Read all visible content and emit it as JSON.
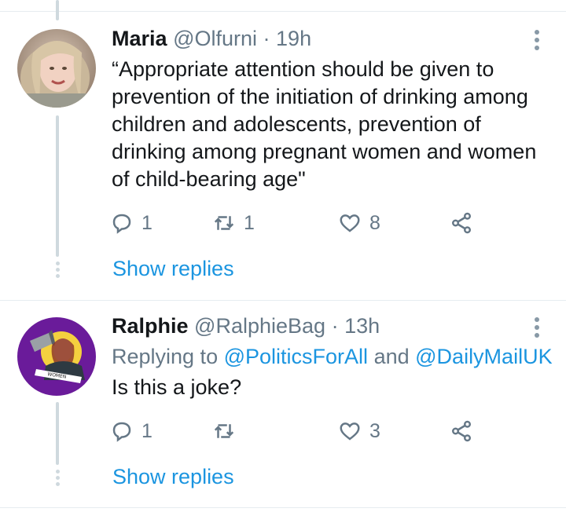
{
  "tweets": [
    {
      "name": "Maria",
      "handle": "@Olfurni",
      "separator": "·",
      "time": "19h",
      "text": "“Appropriate attention should be given to prevention of the initiation of drinking among children and adolescents, prevention of drinking among pregnant women and women of child-bearing age\"",
      "reply_count": "1",
      "retweet_count": "1",
      "like_count": "8",
      "show_replies": "Show replies"
    },
    {
      "name": "Ralphie",
      "handle": "@RalphieBag",
      "separator": "·",
      "time": "13h",
      "replying_prefix": "Replying to",
      "replying_user1": "@PoliticsForAll",
      "replying_and": "and",
      "replying_user2": "@DailyMailUK",
      "text": "Is this a joke?",
      "reply_count": "1",
      "retweet_count": "",
      "like_count": "3",
      "show_replies": "Show replies",
      "avatar_text": "WOMEN WON'T WHEESHT"
    }
  ],
  "colors": {
    "link": "#1b95e0",
    "muted": "#657786",
    "border": "#e6ecf0",
    "avatar2_bg": "#6a1b9a"
  },
  "icons": [
    "reply-icon",
    "retweet-icon",
    "like-icon",
    "share-icon",
    "more-icon"
  ]
}
